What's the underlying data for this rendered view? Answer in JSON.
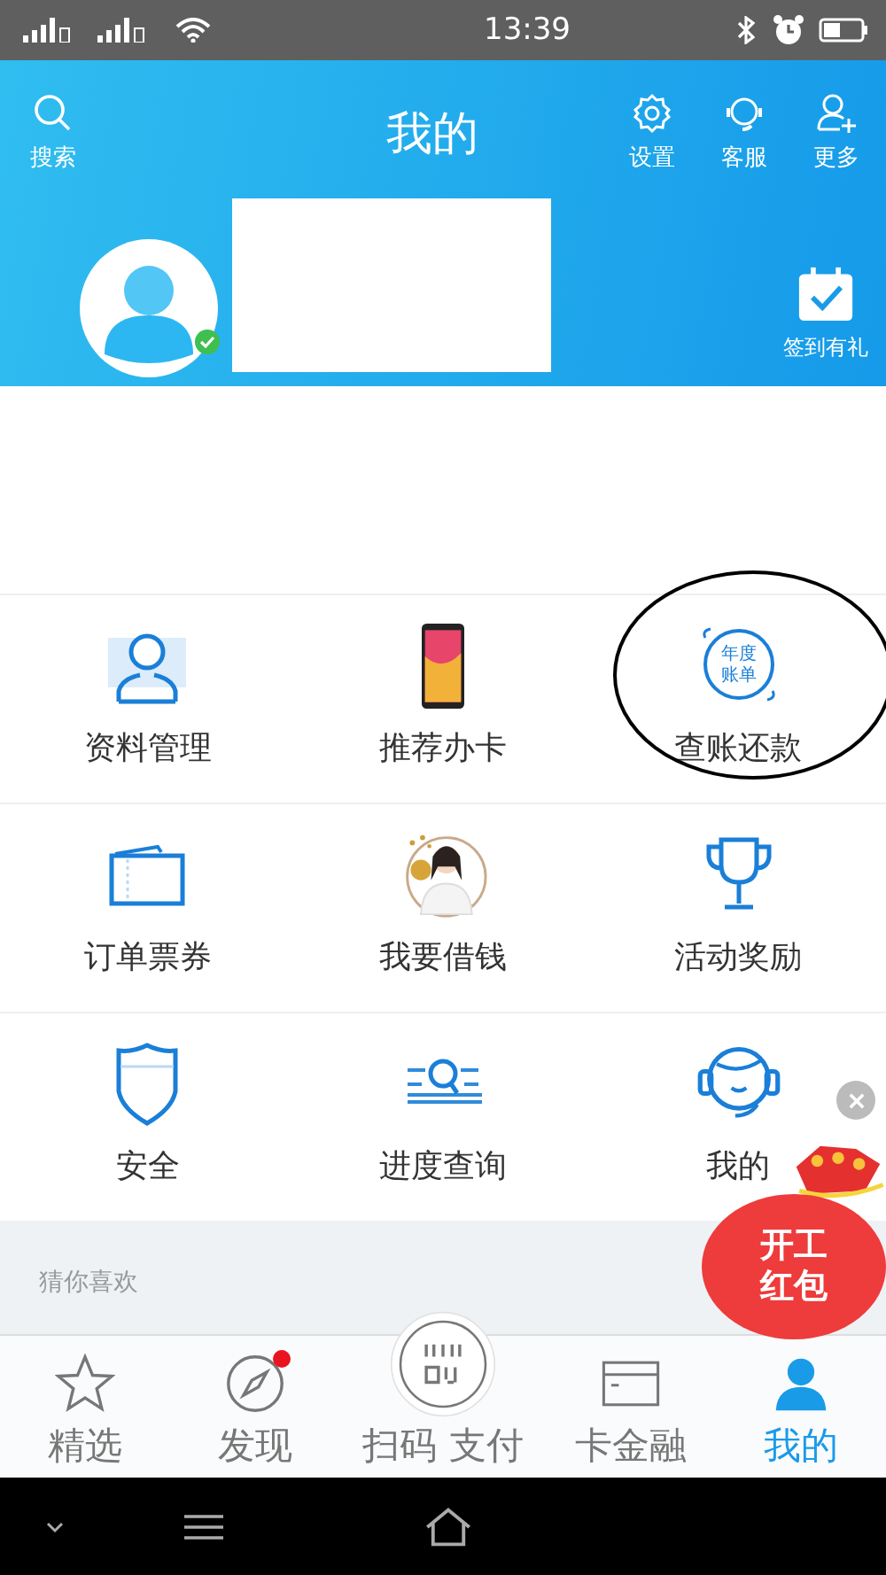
{
  "status_bar": {
    "time": "13:39"
  },
  "header": {
    "title": "我的",
    "search": {
      "label": "搜索"
    },
    "actions": [
      {
        "label": "设置",
        "kind": "gear"
      },
      {
        "label": "客服",
        "kind": "headset"
      },
      {
        "label": "更多",
        "kind": "add-user"
      }
    ],
    "verified": true,
    "checkin": {
      "label": "签到有礼"
    }
  },
  "grid": [
    {
      "label": "资料管理",
      "kind": "person",
      "circled": false
    },
    {
      "label": "推荐办卡",
      "kind": "phone",
      "circled": false
    },
    {
      "label": "查账还款",
      "kind": "bill",
      "circled": true
    },
    {
      "label": "订单票券",
      "kind": "ticket",
      "circled": false
    },
    {
      "label": "我要借钱",
      "kind": "figure",
      "circled": false
    },
    {
      "label": "活动奖励",
      "kind": "trophy",
      "circled": false
    },
    {
      "label": "安全",
      "kind": "shield",
      "circled": false
    },
    {
      "label": "进度查询",
      "kind": "progress",
      "circled": false
    },
    {
      "label": "我的",
      "kind": "headset",
      "circled": false
    }
  ],
  "bill_badge": {
    "lines": [
      "年度",
      "账单"
    ]
  },
  "recommend": {
    "title": "猜你喜欢"
  },
  "promo": {
    "lines": [
      "开工",
      "红包"
    ]
  },
  "tabs": [
    {
      "label": "精选",
      "kind": "star",
      "selected": false,
      "dot": false
    },
    {
      "label": "发现",
      "kind": "compass",
      "selected": false,
      "dot": true
    },
    {
      "label": "扫码 支付",
      "kind": "scan",
      "selected": false,
      "dot": false
    },
    {
      "label": "卡金融",
      "kind": "card",
      "selected": false,
      "dot": false
    },
    {
      "label": "我的",
      "kind": "user",
      "selected": true,
      "dot": false
    }
  ]
}
